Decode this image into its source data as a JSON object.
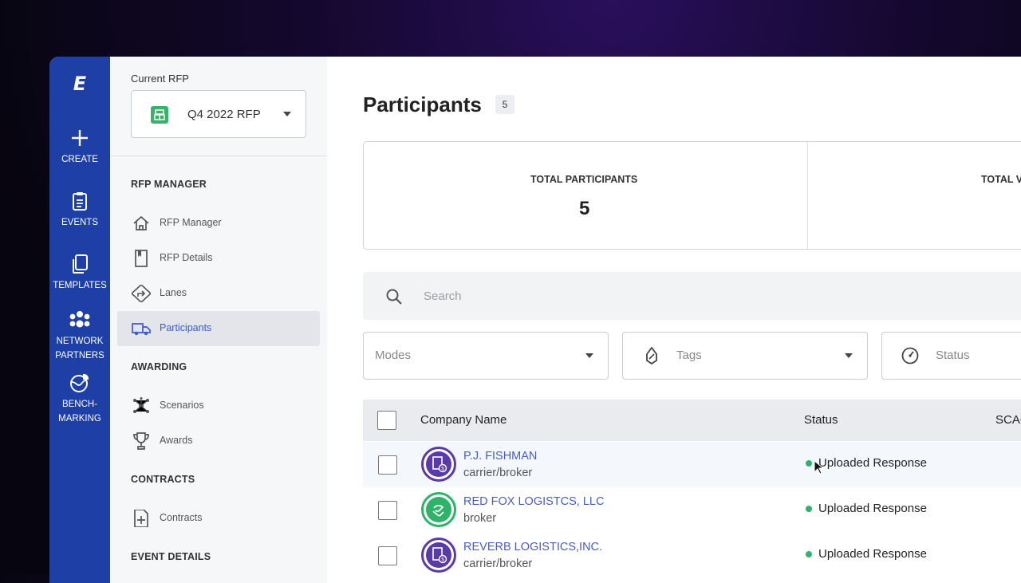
{
  "rail": {
    "logo": "E",
    "items": [
      {
        "label": "CREATE",
        "icon": "plus-icon"
      },
      {
        "label": "EVENTS",
        "icon": "clipboard-icon"
      },
      {
        "label": "TEMPLATES",
        "icon": "copy-icon"
      },
      {
        "label_line1": "NETWORK",
        "label_line2": "PARTNERS",
        "icon": "people-icon"
      },
      {
        "label_line1": "BENCH-",
        "label_line2": "MARKING",
        "icon": "globe-chart-icon"
      }
    ]
  },
  "nav": {
    "current_label": "Current RFP",
    "current_value": "Q4 2022 RFP",
    "sections": {
      "rfp_manager": "RFP MANAGER",
      "awarding": "AWARDING",
      "contracts": "CONTRACTS",
      "event_details": "EVENT DETAILS"
    },
    "items": {
      "rfp_manager": "RFP Manager",
      "rfp_details": "RFP Details",
      "lanes": "Lanes",
      "participants": "Participants",
      "scenarios": "Scenarios",
      "awards": "Awards",
      "contracts": "Contracts"
    }
  },
  "main": {
    "title": "Participants",
    "count": "5",
    "stats": [
      {
        "label": "TOTAL PARTICIPANTS",
        "value": "5"
      },
      {
        "label": "TOTAL V"
      }
    ],
    "search_placeholder": "Search",
    "filters": {
      "modes": "Modes",
      "tags": "Tags",
      "status": "Status"
    },
    "columns": {
      "company": "Company Name",
      "status": "Status",
      "scac": "SCAC"
    },
    "rows": [
      {
        "name": "P.J. FISHMAN",
        "type": "carrier/broker",
        "status": "Uploaded Response"
      },
      {
        "name": "RED FOX LOGISTCS, LLC",
        "type": "broker",
        "status": "Uploaded Response"
      },
      {
        "name": "REVERB LOGISTICS,INC.",
        "type": "carrier/broker",
        "status": "Uploaded Response"
      }
    ]
  },
  "colors": {
    "rail": "#1d3fa6",
    "link": "#4a5cc0",
    "status_green": "#2fb36a",
    "avatar_purple": "#5a3aa6",
    "avatar_green": "#2fb36a"
  }
}
